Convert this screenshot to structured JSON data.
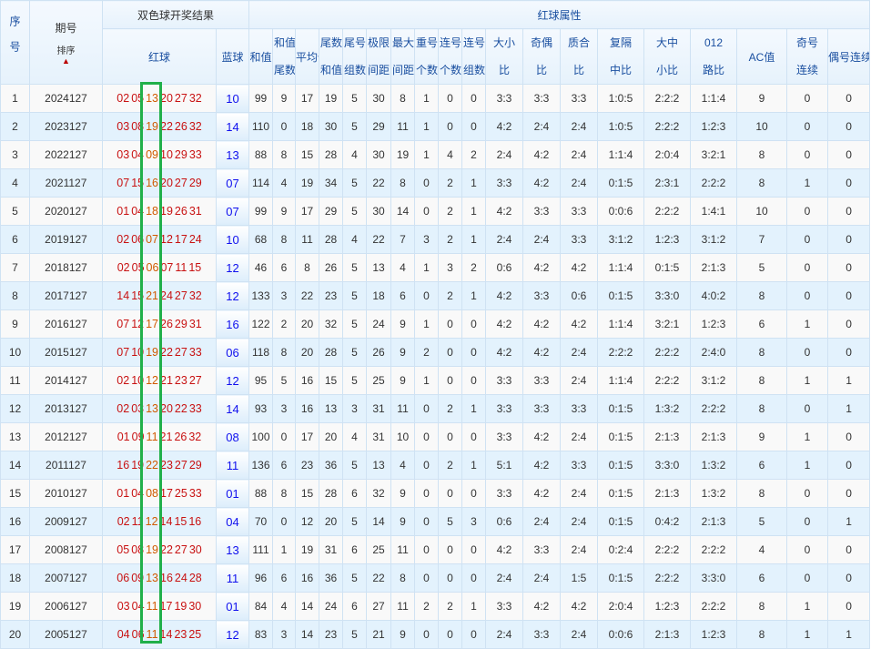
{
  "header": {
    "seq": "序号",
    "issue": "期号",
    "sort_label": "排序",
    "sort_icon": "arrow-up",
    "draw_group": "双色球开奖结果",
    "attr_group": "红球属性",
    "red": "红球",
    "blue": "蓝球",
    "cols": [
      "和值",
      "和值尾数",
      "平均值",
      "尾数和值",
      "尾号组数",
      "极限间距",
      "最大间距",
      "重号个数",
      "连号个数",
      "连号组数",
      "大小比",
      "奇偶比",
      "质合比",
      "复隔中比",
      "大中小比",
      "012路比",
      "AC值",
      "奇号连续",
      "偶号连续"
    ]
  },
  "colors": {
    "highlight_box": "#21b04a",
    "red_ball": "#c81212",
    "blue_ball": "#1010ee"
  },
  "rows": [
    {
      "seq": "1",
      "issue": "2024127",
      "red": [
        "02",
        "05",
        "13",
        "20",
        "27",
        "32"
      ],
      "blue": "10",
      "v": [
        "99",
        "9",
        "17",
        "19",
        "5",
        "30",
        "8",
        "1",
        "0",
        "0",
        "3:3",
        "3:3",
        "3:3",
        "1:0:5",
        "2:2:2",
        "1:1:4",
        "9",
        "0",
        "0"
      ]
    },
    {
      "seq": "2",
      "issue": "2023127",
      "red": [
        "03",
        "08",
        "19",
        "22",
        "26",
        "32"
      ],
      "blue": "14",
      "v": [
        "110",
        "0",
        "18",
        "30",
        "5",
        "29",
        "11",
        "1",
        "0",
        "0",
        "4:2",
        "2:4",
        "2:4",
        "1:0:5",
        "2:2:2",
        "1:2:3",
        "10",
        "0",
        "0"
      ]
    },
    {
      "seq": "3",
      "issue": "2022127",
      "red": [
        "03",
        "04",
        "09",
        "10",
        "29",
        "33"
      ],
      "blue": "13",
      "v": [
        "88",
        "8",
        "15",
        "28",
        "4",
        "30",
        "19",
        "1",
        "4",
        "2",
        "2:4",
        "4:2",
        "2:4",
        "1:1:4",
        "2:0:4",
        "3:2:1",
        "8",
        "0",
        "0"
      ]
    },
    {
      "seq": "4",
      "issue": "2021127",
      "red": [
        "07",
        "15",
        "16",
        "20",
        "27",
        "29"
      ],
      "blue": "07",
      "v": [
        "114",
        "4",
        "19",
        "34",
        "5",
        "22",
        "8",
        "0",
        "2",
        "1",
        "3:3",
        "4:2",
        "2:4",
        "0:1:5",
        "2:3:1",
        "2:2:2",
        "8",
        "1",
        "0"
      ]
    },
    {
      "seq": "5",
      "issue": "2020127",
      "red": [
        "01",
        "04",
        "18",
        "19",
        "26",
        "31"
      ],
      "blue": "07",
      "v": [
        "99",
        "9",
        "17",
        "29",
        "5",
        "30",
        "14",
        "0",
        "2",
        "1",
        "4:2",
        "3:3",
        "3:3",
        "0:0:6",
        "2:2:2",
        "1:4:1",
        "10",
        "0",
        "0"
      ]
    },
    {
      "seq": "6",
      "issue": "2019127",
      "red": [
        "02",
        "06",
        "07",
        "12",
        "17",
        "24"
      ],
      "blue": "10",
      "v": [
        "68",
        "8",
        "11",
        "28",
        "4",
        "22",
        "7",
        "3",
        "2",
        "1",
        "2:4",
        "2:4",
        "3:3",
        "3:1:2",
        "1:2:3",
        "3:1:2",
        "7",
        "0",
        "0"
      ]
    },
    {
      "seq": "7",
      "issue": "2018127",
      "red": [
        "02",
        "05",
        "06",
        "07",
        "11",
        "15"
      ],
      "blue": "12",
      "v": [
        "46",
        "6",
        "8",
        "26",
        "5",
        "13",
        "4",
        "1",
        "3",
        "2",
        "0:6",
        "4:2",
        "4:2",
        "1:1:4",
        "0:1:5",
        "2:1:3",
        "5",
        "0",
        "0"
      ]
    },
    {
      "seq": "8",
      "issue": "2017127",
      "red": [
        "14",
        "15",
        "21",
        "24",
        "27",
        "32"
      ],
      "blue": "12",
      "v": [
        "133",
        "3",
        "22",
        "23",
        "5",
        "18",
        "6",
        "0",
        "2",
        "1",
        "4:2",
        "3:3",
        "0:6",
        "0:1:5",
        "3:3:0",
        "4:0:2",
        "8",
        "0",
        "0"
      ]
    },
    {
      "seq": "9",
      "issue": "2016127",
      "red": [
        "07",
        "12",
        "17",
        "26",
        "29",
        "31"
      ],
      "blue": "16",
      "v": [
        "122",
        "2",
        "20",
        "32",
        "5",
        "24",
        "9",
        "1",
        "0",
        "0",
        "4:2",
        "4:2",
        "4:2",
        "1:1:4",
        "3:2:1",
        "1:2:3",
        "6",
        "1",
        "0"
      ]
    },
    {
      "seq": "10",
      "issue": "2015127",
      "red": [
        "07",
        "10",
        "19",
        "22",
        "27",
        "33"
      ],
      "blue": "06",
      "v": [
        "118",
        "8",
        "20",
        "28",
        "5",
        "26",
        "9",
        "2",
        "0",
        "0",
        "4:2",
        "4:2",
        "2:4",
        "2:2:2",
        "2:2:2",
        "2:4:0",
        "8",
        "0",
        "0"
      ]
    },
    {
      "seq": "11",
      "issue": "2014127",
      "red": [
        "02",
        "10",
        "12",
        "21",
        "23",
        "27"
      ],
      "blue": "12",
      "v": [
        "95",
        "5",
        "16",
        "15",
        "5",
        "25",
        "9",
        "1",
        "0",
        "0",
        "3:3",
        "3:3",
        "2:4",
        "1:1:4",
        "2:2:2",
        "3:1:2",
        "8",
        "1",
        "1"
      ]
    },
    {
      "seq": "12",
      "issue": "2013127",
      "red": [
        "02",
        "03",
        "13",
        "20",
        "22",
        "33"
      ],
      "blue": "14",
      "v": [
        "93",
        "3",
        "16",
        "13",
        "3",
        "31",
        "11",
        "0",
        "2",
        "1",
        "3:3",
        "3:3",
        "3:3",
        "0:1:5",
        "1:3:2",
        "2:2:2",
        "8",
        "0",
        "1"
      ]
    },
    {
      "seq": "13",
      "issue": "2012127",
      "red": [
        "01",
        "09",
        "11",
        "21",
        "26",
        "32"
      ],
      "blue": "08",
      "v": [
        "100",
        "0",
        "17",
        "20",
        "4",
        "31",
        "10",
        "0",
        "0",
        "0",
        "3:3",
        "4:2",
        "2:4",
        "0:1:5",
        "2:1:3",
        "2:1:3",
        "9",
        "1",
        "0"
      ]
    },
    {
      "seq": "14",
      "issue": "2011127",
      "red": [
        "16",
        "19",
        "22",
        "23",
        "27",
        "29"
      ],
      "blue": "11",
      "v": [
        "136",
        "6",
        "23",
        "36",
        "5",
        "13",
        "4",
        "0",
        "2",
        "1",
        "5:1",
        "4:2",
        "3:3",
        "0:1:5",
        "3:3:0",
        "1:3:2",
        "6",
        "1",
        "0"
      ]
    },
    {
      "seq": "15",
      "issue": "2010127",
      "red": [
        "01",
        "04",
        "08",
        "17",
        "25",
        "33"
      ],
      "blue": "01",
      "v": [
        "88",
        "8",
        "15",
        "28",
        "6",
        "32",
        "9",
        "0",
        "0",
        "0",
        "3:3",
        "4:2",
        "2:4",
        "0:1:5",
        "2:1:3",
        "1:3:2",
        "8",
        "0",
        "0"
      ]
    },
    {
      "seq": "16",
      "issue": "2009127",
      "red": [
        "02",
        "11",
        "12",
        "14",
        "15",
        "16"
      ],
      "blue": "04",
      "v": [
        "70",
        "0",
        "12",
        "20",
        "5",
        "14",
        "9",
        "0",
        "5",
        "3",
        "0:6",
        "2:4",
        "2:4",
        "0:1:5",
        "0:4:2",
        "2:1:3",
        "5",
        "0",
        "1"
      ]
    },
    {
      "seq": "17",
      "issue": "2008127",
      "red": [
        "05",
        "08",
        "19",
        "22",
        "27",
        "30"
      ],
      "blue": "13",
      "v": [
        "111",
        "1",
        "19",
        "31",
        "6",
        "25",
        "11",
        "0",
        "0",
        "0",
        "4:2",
        "3:3",
        "2:4",
        "0:2:4",
        "2:2:2",
        "2:2:2",
        "4",
        "0",
        "0"
      ]
    },
    {
      "seq": "18",
      "issue": "2007127",
      "red": [
        "06",
        "09",
        "13",
        "16",
        "24",
        "28"
      ],
      "blue": "11",
      "v": [
        "96",
        "6",
        "16",
        "36",
        "5",
        "22",
        "8",
        "0",
        "0",
        "0",
        "2:4",
        "2:4",
        "1:5",
        "0:1:5",
        "2:2:2",
        "3:3:0",
        "6",
        "0",
        "0"
      ]
    },
    {
      "seq": "19",
      "issue": "2006127",
      "red": [
        "03",
        "04",
        "11",
        "17",
        "19",
        "30"
      ],
      "blue": "01",
      "v": [
        "84",
        "4",
        "14",
        "24",
        "6",
        "27",
        "11",
        "2",
        "2",
        "1",
        "3:3",
        "4:2",
        "4:2",
        "2:0:4",
        "1:2:3",
        "2:2:2",
        "8",
        "1",
        "0"
      ]
    },
    {
      "seq": "20",
      "issue": "2005127",
      "red": [
        "04",
        "06",
        "11",
        "14",
        "23",
        "25"
      ],
      "blue": "12",
      "v": [
        "83",
        "3",
        "14",
        "23",
        "5",
        "21",
        "9",
        "0",
        "0",
        "0",
        "2:4",
        "3:3",
        "2:4",
        "0:0:6",
        "2:1:3",
        "1:2:3",
        "8",
        "1",
        "1"
      ]
    }
  ]
}
